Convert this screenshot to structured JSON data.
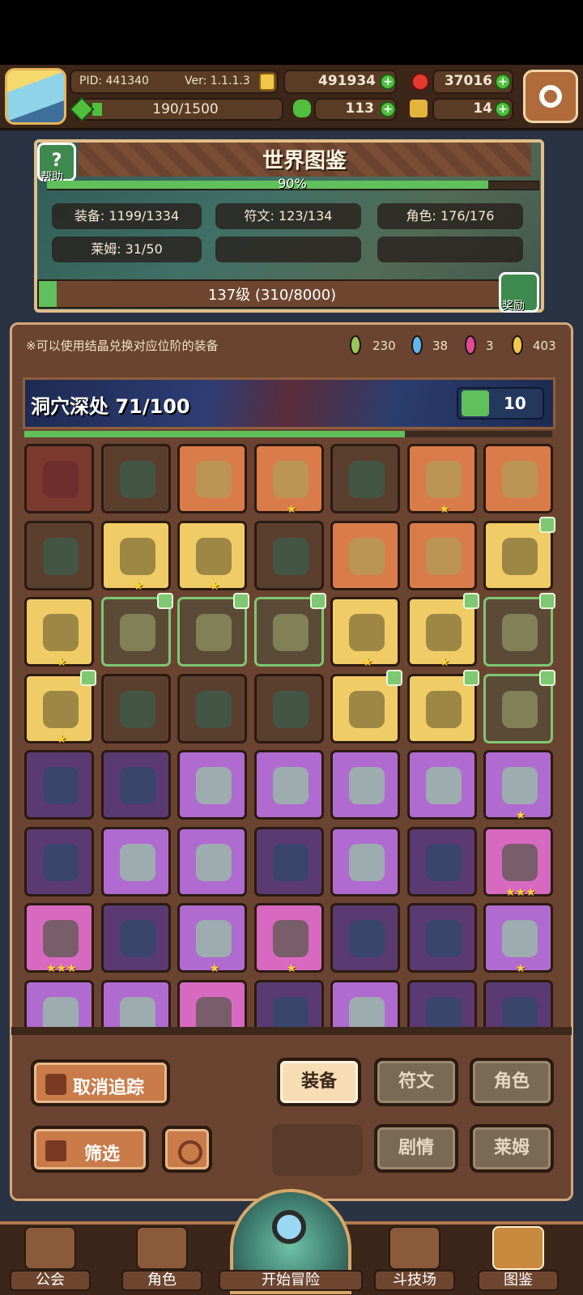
{
  "header": {
    "pid": "PID: 441340",
    "version": "Ver: 1.1.1.3",
    "gold": "491934",
    "gems": "37016",
    "stamina": "190/1500",
    "clovers": "113",
    "tickets": "14",
    "plus": "+"
  },
  "world": {
    "title": "世界图鉴",
    "help_label": "帮助",
    "help_icon": "?",
    "progress": "90%",
    "stats": {
      "equip": "装备: 1199/1334",
      "rune": "符文: 123/134",
      "role": "角色: 176/176",
      "slime": "莱姆: 31/50"
    },
    "level": "137级 (310/8000)",
    "reward_label": "奖励"
  },
  "panel": {
    "hint": "※可以使用结晶兑换对应位阶的装备",
    "crystals": {
      "green": "230",
      "blue": "38",
      "pink": "3",
      "gold": "403"
    },
    "area_name": "洞穴深处  71/100",
    "likes": "10"
  },
  "grid_rows": [
    [
      {
        "bg": "red"
      },
      {
        "bg": "dark"
      },
      {
        "bg": "orange"
      },
      {
        "bg": "orange",
        "stars": "★"
      },
      {
        "bg": "dark"
      },
      {
        "bg": "orange",
        "stars": "★"
      },
      {
        "bg": "orange"
      }
    ],
    [
      {
        "bg": "dark"
      },
      {
        "bg": "gold",
        "stars": "★"
      },
      {
        "bg": "gold",
        "stars": "★"
      },
      {
        "bg": "dark"
      },
      {
        "bg": "orange"
      },
      {
        "bg": "orange"
      },
      {
        "bg": "gold",
        "thumb": true
      }
    ],
    [
      {
        "bg": "gold",
        "stars": "★"
      },
      {
        "bg": "green",
        "thumb": true
      },
      {
        "bg": "green",
        "thumb": true
      },
      {
        "bg": "green",
        "thumb": true
      },
      {
        "bg": "gold",
        "stars": "★"
      },
      {
        "bg": "gold",
        "stars": "★",
        "thumb": true
      },
      {
        "bg": "green",
        "thumb": true
      }
    ],
    [
      {
        "bg": "gold",
        "stars": "★",
        "thumb": true
      },
      {
        "bg": "dark"
      },
      {
        "bg": "dark"
      },
      {
        "bg": "dark"
      },
      {
        "bg": "gold",
        "thumb": true
      },
      {
        "bg": "gold",
        "thumb": true
      },
      {
        "bg": "green",
        "thumb": true
      }
    ],
    [
      {
        "bg": "purple"
      },
      {
        "bg": "purple"
      },
      {
        "bg": "violet"
      },
      {
        "bg": "violet"
      },
      {
        "bg": "violet"
      },
      {
        "bg": "violet"
      },
      {
        "bg": "violet",
        "stars": "★"
      }
    ],
    [
      {
        "bg": "purple"
      },
      {
        "bg": "violet"
      },
      {
        "bg": "violet"
      },
      {
        "bg": "purple"
      },
      {
        "bg": "violet"
      },
      {
        "bg": "purple"
      },
      {
        "bg": "pink",
        "stars": "★★★"
      }
    ],
    [
      {
        "bg": "pink",
        "stars": "★★★"
      },
      {
        "bg": "purple"
      },
      {
        "bg": "violet",
        "stars": "★"
      },
      {
        "bg": "pink",
        "stars": "★"
      },
      {
        "bg": "purple"
      },
      {
        "bg": "purple"
      },
      {
        "bg": "violet",
        "stars": "★"
      }
    ],
    [
      {
        "bg": "violet"
      },
      {
        "bg": "violet"
      },
      {
        "bg": "pink"
      },
      {
        "bg": "purple"
      },
      {
        "bg": "violet"
      },
      {
        "bg": "purple"
      },
      {
        "bg": "purple"
      }
    ]
  ],
  "buttons": {
    "untrack": "取消追踪",
    "filter": "筛选",
    "equip": "装备",
    "rune": "符文",
    "role": "角色",
    "story": "剧情",
    "slime": "莱姆"
  },
  "nav": {
    "guild": "公会",
    "role": "角色",
    "start": "开始冒险",
    "arena": "斗技场",
    "codex": "图鉴"
  }
}
